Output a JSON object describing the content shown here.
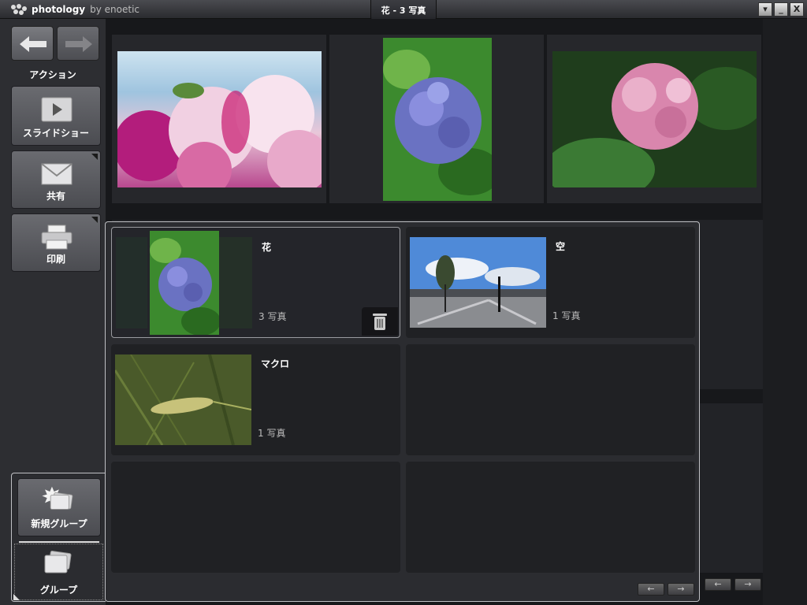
{
  "titlebar": {
    "brand": "photology",
    "brand_by": "by enoetic",
    "window_title": "花 - 3 写真",
    "buttons": [
      "▾",
      "_",
      "X"
    ]
  },
  "sidebar": {
    "back_icon": "left-arrow-icon",
    "forward_icon": "right-arrow-icon",
    "section_label": "アクション",
    "actions": [
      {
        "label": "スライドショー",
        "icon": "play-icon"
      },
      {
        "label": "共有",
        "icon": "envelope-icon"
      },
      {
        "label": "印刷",
        "icon": "printer-icon"
      }
    ],
    "new_group": "新規グループ",
    "groups": "グループ"
  },
  "groups": [
    {
      "name": "花",
      "count": "3 写真"
    },
    {
      "name": "空",
      "count": "1 写真"
    },
    {
      "name": "マクロ",
      "count": "1 写真"
    }
  ],
  "pager": {
    "prev": "←",
    "next": "→"
  },
  "colors": {
    "bg": "#1c1d20",
    "panel": "#2b2c30",
    "accent": "#bfc0c4"
  }
}
